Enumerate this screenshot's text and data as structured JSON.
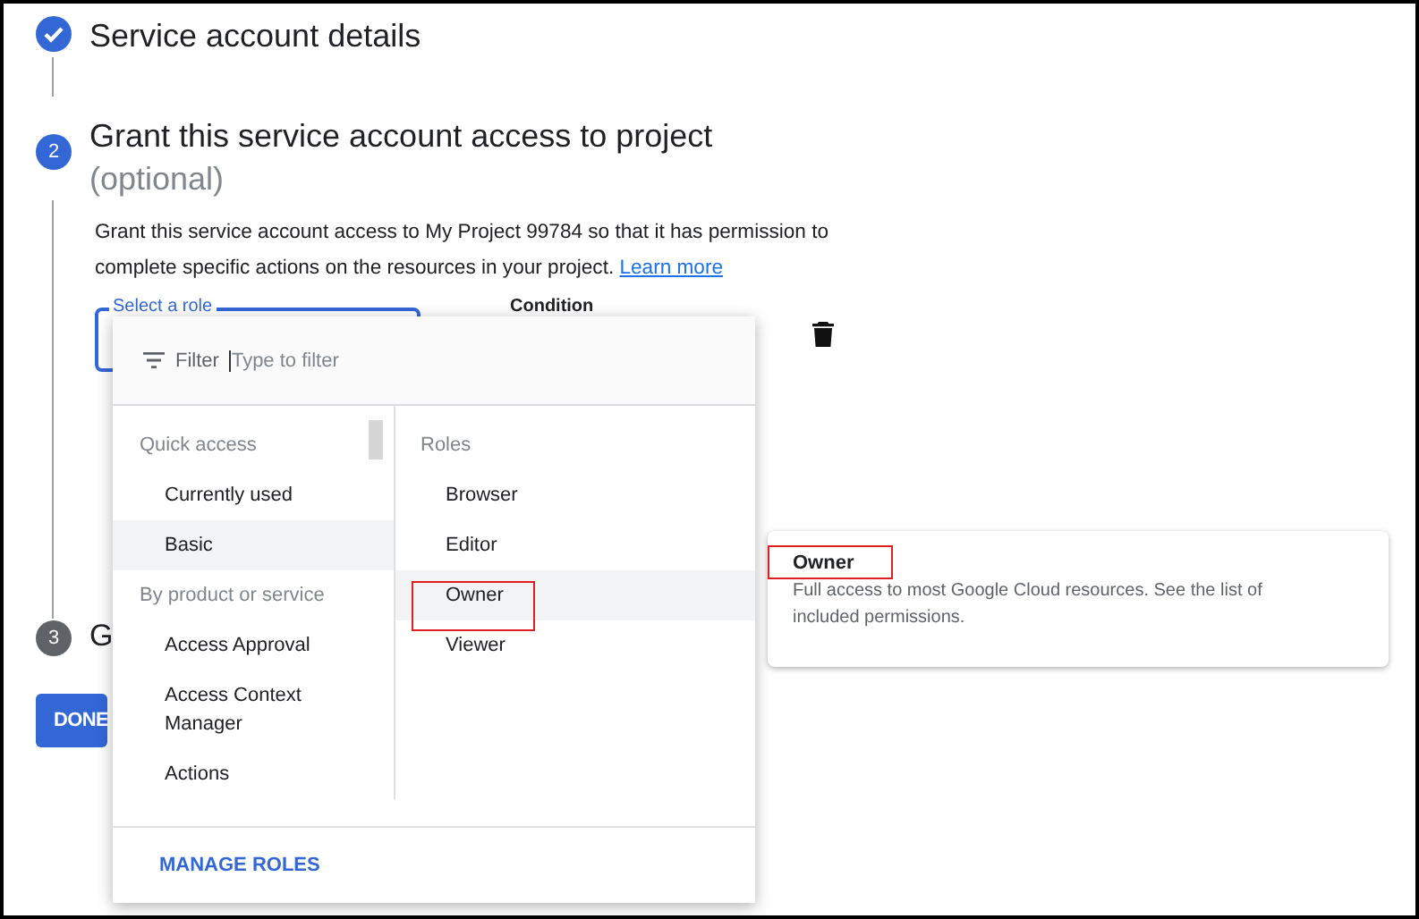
{
  "steps": [
    {
      "done": true,
      "title": "Service account details"
    },
    {
      "done": false,
      "number": "2",
      "current": true,
      "title": "Grant this service account access to project",
      "subtitle": "(optional)",
      "description": "Grant this service account access to My Project 99784 so that it has permission to complete specific actions on the resources in your project.",
      "link": "Learn more",
      "role_field": {
        "label": "Select a role"
      },
      "condition_label": "Condition"
    },
    {
      "done": false,
      "number": "3",
      "current": false,
      "title": "G"
    }
  ],
  "done_button": "DONE",
  "role_menu": {
    "filter_label": "Filter",
    "placeholder": "Type to filter",
    "categories": [
      {
        "kind": "header",
        "label": "Quick access"
      },
      {
        "kind": "item",
        "label": "Currently used",
        "selected": false
      },
      {
        "kind": "item",
        "label": "Basic",
        "selected": true
      },
      {
        "kind": "header",
        "label": "By product or service"
      },
      {
        "kind": "item",
        "label": "Access Approval",
        "selected": false
      },
      {
        "kind": "item",
        "label": "Access Context Manager",
        "selected": false
      },
      {
        "kind": "item",
        "label": "Actions",
        "selected": false
      }
    ],
    "roles_header": "Roles",
    "roles": [
      {
        "label": "Browser",
        "selected": false,
        "annotated": false
      },
      {
        "label": "Editor",
        "selected": false,
        "annotated": false
      },
      {
        "label": "Owner",
        "selected": true,
        "annotated": true
      },
      {
        "label": "Viewer",
        "selected": false,
        "annotated": false
      }
    ],
    "manage_button": "MANAGE ROLES"
  },
  "role_info": {
    "title": "Owner",
    "annotated": true,
    "description": "Full access to most Google Cloud resources. See the list of included permissions."
  }
}
